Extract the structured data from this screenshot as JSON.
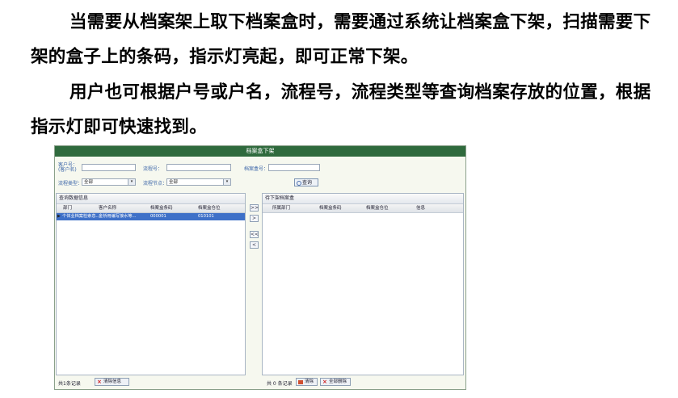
{
  "paragraphs": [
    "当需要从档案架上取下档案盒时，需要通过系统让档案盒下架，扫描需要下架的盒子上的条码，指示灯亮起，即可正常下架。",
    "用户也可根据户号或户名，流程号，流程类型等查询档案存放的位置，根据指示灯即可快速找到。"
  ],
  "window": {
    "title": "档案盒下架",
    "query": {
      "customer_label": "客户号：(客户名)",
      "customer_label_1": "客户号：",
      "customer_label_2": "(客户名)",
      "process_no_label": "流程号：",
      "box_no_label": "档案盒号：",
      "process_type_label": "流程类型：",
      "process_type_value": "全部",
      "process_node_label": "流程节点：",
      "process_node_value": "全部",
      "query_button": "查询"
    },
    "left_panel": {
      "title": "查询数据信息",
      "columns": [
        "部门",
        "客户名称",
        "档案盒条码",
        "档案盒仓位"
      ],
      "rows": [
        [
          "个体业档案检索息...",
          "金桥用编写接水等...",
          "000001",
          "010101"
        ]
      ],
      "footer_count": "共1条记录",
      "footer_button": "清除信息"
    },
    "move_buttons": [
      ">>",
      ">",
      "<<",
      "<"
    ],
    "right_panel": {
      "title": "待下架档案盒",
      "columns": [
        "所属部门",
        "档案盒条码",
        "档案盒仓位",
        "信息"
      ],
      "footer_count": "共 0 条记录",
      "button_remove": "清除",
      "button_all_remove": "全部删除"
    }
  }
}
